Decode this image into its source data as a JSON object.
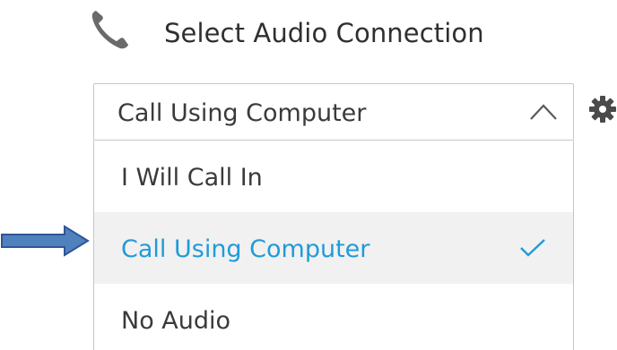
{
  "header": {
    "title": "Select Audio Connection",
    "icon": "phone-icon"
  },
  "audio_select": {
    "selected_value": "Call Using Computer",
    "expanded": true,
    "toggle_icon": "chevron-up-icon",
    "options": [
      {
        "label": "I Will Call In",
        "selected": false
      },
      {
        "label": "Call Using Computer",
        "selected": true,
        "icon": "check-icon"
      },
      {
        "label": "No Audio",
        "selected": false
      }
    ]
  },
  "settings": {
    "icon": "gear-icon"
  },
  "annotation": {
    "icon": "pointer-arrow-icon"
  },
  "colors": {
    "accent": "#1f9bd9",
    "text": "#3a3a3a",
    "border": "#c6c6c6",
    "selected_bg": "#f1f1f1",
    "icon_gray": "#6a6a6a",
    "arrow_fill": "#4f81bd",
    "arrow_stroke": "#2f5597"
  }
}
